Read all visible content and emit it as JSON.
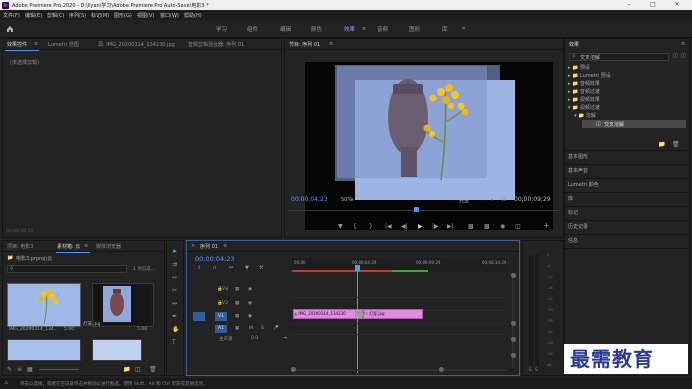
{
  "window": {
    "title": "Adobe Premiere Pro 2020 - D:\\liyan\\学习\\Adobe Premiere Pro Auto-Save\\电影3 *",
    "logo": "Pr"
  },
  "menu": [
    "文件(F)",
    "编辑(E)",
    "剪辑(C)",
    "序列(S)",
    "标记(M)",
    "图形(G)",
    "视图(V)",
    "窗口(W)",
    "帮助(H)"
  ],
  "workspaces": [
    "学习",
    "组件",
    "编辑",
    "颜色",
    "效果",
    "音频",
    "图形",
    "库"
  ],
  "workspace_active": "效果",
  "source_panel": {
    "tabs": [
      "效果控件",
      "Lumetri 范围",
      "源: IMG_20200314_134230.jpg",
      "音频剪辑混合器: 序列 01"
    ],
    "empty_text": "(未选择剪辑)",
    "timecode": "00;00;00;00"
  },
  "program_monitor": {
    "tab": "节目: 序列 01",
    "timecode": "00;00;04;23",
    "zoom": "50%",
    "quality": "完整",
    "duration": "00;00;09;29"
  },
  "project_panel": {
    "tabs": [
      "项目: 电影3",
      "素材箱: 云",
      "媒体浏览器"
    ],
    "path": "电影3.prproj\\云",
    "count": "1 项已选...",
    "items": [
      {
        "name": "IMG_20200314_134...",
        "duration": "5:00"
      },
      {
        "name": "灯笼.jpg",
        "duration": "5:00"
      }
    ]
  },
  "timeline": {
    "tab": "序列 01",
    "timecode": "00;00;04;23",
    "ruler": [
      "00;00",
      "00;00;04;29",
      "00;00;09;29",
      "00;00;14;29"
    ],
    "video_tracks": [
      "V3",
      "V2",
      "V1"
    ],
    "audio_tracks": [
      "A1"
    ],
    "track_buttons": [
      "M",
      "S"
    ],
    "master": {
      "label": "主声道",
      "value": "0.0"
    },
    "clips": [
      {
        "label": "IMG_20200314_134230"
      },
      {
        "label": "灯笼.jpg"
      }
    ],
    "clip_fx": "fx"
  },
  "audio_meter": {
    "scale": [
      "0",
      "-6",
      "-12",
      "-18",
      "-24",
      "-30",
      "-36",
      "-42",
      "-48",
      "-54",
      "dB"
    ],
    "channels": [
      "S",
      "S"
    ]
  },
  "effects_panel": {
    "title": "效果",
    "search": "交叉溶解",
    "tree": [
      {
        "label": "预设",
        "indent": 0
      },
      {
        "label": "Lumetri 预设",
        "indent": 0
      },
      {
        "label": "音频效果",
        "indent": 0
      },
      {
        "label": "音频过渡",
        "indent": 0
      },
      {
        "label": "视频效果",
        "indent": 0
      },
      {
        "label": "视频过渡",
        "indent": 0
      },
      {
        "label": "溶解",
        "indent": 1
      },
      {
        "label": "交叉溶解",
        "indent": 2,
        "selected": true
      }
    ],
    "sections": [
      "基本图形",
      "基本声音",
      "Lumetri 颜色",
      "库",
      "标记",
      "历史记录",
      "信息"
    ]
  },
  "status_bar": {
    "text": "单击以选择，或者在空白处单击并拖动以进行框选。使用 Shift、Alt 和 Ctrl 可获得其他选项。"
  },
  "watermark": "最需教育",
  "colors": {
    "accent": "#4e9aff",
    "clip": "#e389e3",
    "panel_bg": "#232323"
  }
}
